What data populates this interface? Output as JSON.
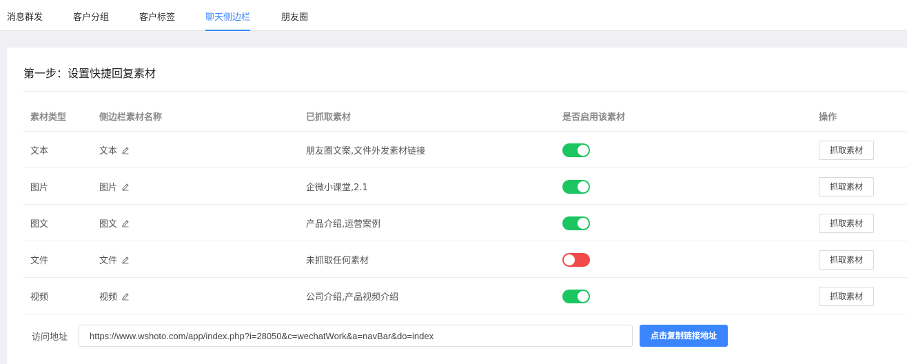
{
  "tabs": [
    {
      "label": "消息群发"
    },
    {
      "label": "客户分组"
    },
    {
      "label": "客户标签"
    },
    {
      "label": "聊天侧边栏"
    },
    {
      "label": "朋友圈"
    }
  ],
  "active_tab": "聊天侧边栏",
  "section_title": "第一步：设置快捷回复素材",
  "table": {
    "headers": [
      "素材类型",
      "侧边栏素材名称",
      "已抓取素材",
      "是否启用该素材",
      "操作"
    ],
    "rows": [
      {
        "type": "文本",
        "name": "文本",
        "fetched": "朋友圈文案,文件外发素材链接",
        "enabled": true,
        "action": "抓取素材"
      },
      {
        "type": "图片",
        "name": "图片",
        "fetched": "企微小课堂,2.1",
        "enabled": true,
        "action": "抓取素材"
      },
      {
        "type": "图文",
        "name": "图文",
        "fetched": "产品介绍,运营案例",
        "enabled": true,
        "action": "抓取素材"
      },
      {
        "type": "文件",
        "name": "文件",
        "fetched": "未抓取任何素材",
        "enabled": false,
        "action": "抓取素材"
      },
      {
        "type": "视频",
        "name": "视频",
        "fetched": "公司介绍,产品视频介绍",
        "enabled": true,
        "action": "抓取素材"
      }
    ]
  },
  "access": {
    "label": "访问地址",
    "url": "https://www.wshoto.com/app/index.php?i=28050&c=wechatWork&a=navBar&do=index",
    "copy_label": "点击复制链接地址"
  },
  "colors": {
    "accent": "#3b86ff",
    "switch_on": "#1bc661",
    "switch_off": "#f04a4a"
  },
  "icons": {
    "edit": "pencil-icon"
  }
}
